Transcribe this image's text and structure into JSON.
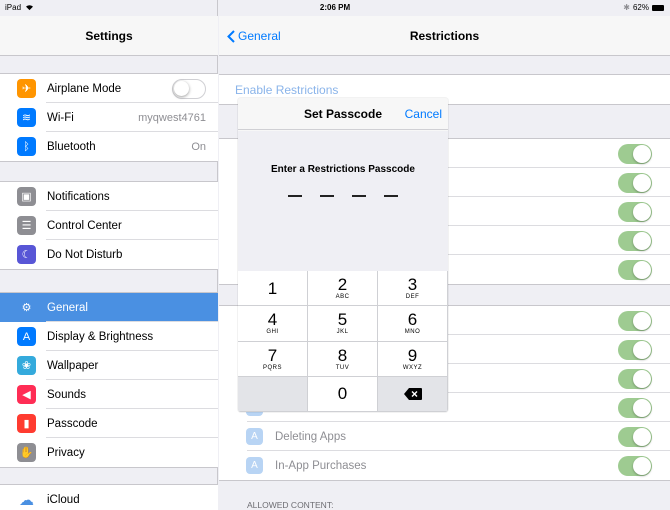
{
  "status": {
    "device": "iPad",
    "time": "2:06 PM",
    "battery": "62%"
  },
  "sidebar": {
    "title": "Settings",
    "groups": [
      [
        {
          "label": "Airplane Mode",
          "icon": "airplane-icon",
          "color": "#ff9500",
          "toggle": "off"
        },
        {
          "label": "Wi-Fi",
          "icon": "wifi-icon",
          "color": "#007aff",
          "value": "myqwest4761"
        },
        {
          "label": "Bluetooth",
          "icon": "bluetooth-icon",
          "color": "#007aff",
          "value": "On"
        }
      ],
      [
        {
          "label": "Notifications",
          "icon": "notifications-icon",
          "color": "#8e8e93"
        },
        {
          "label": "Control Center",
          "icon": "control-center-icon",
          "color": "#8e8e93"
        },
        {
          "label": "Do Not Disturb",
          "icon": "moon-icon",
          "color": "#5856d6"
        }
      ],
      [
        {
          "label": "General",
          "icon": "gear-icon",
          "color": "#8e8e93",
          "active": true
        },
        {
          "label": "Display & Brightness",
          "icon": "display-icon",
          "color": "#007aff"
        },
        {
          "label": "Wallpaper",
          "icon": "wallpaper-icon",
          "color": "#34aadc"
        },
        {
          "label": "Sounds",
          "icon": "speaker-icon",
          "color": "#ff2d55"
        },
        {
          "label": "Passcode",
          "icon": "lock-icon",
          "color": "#ff3b30"
        },
        {
          "label": "Privacy",
          "icon": "hand-icon",
          "color": "#8e8e93"
        }
      ],
      [
        {
          "label": "iCloud",
          "icon": "cloud-icon",
          "color": "#ffffff"
        }
      ]
    ]
  },
  "main": {
    "back_label": "General",
    "title": "Restrictions",
    "enable_label": "Enable Restrictions",
    "rows": [
      {
        "label": "Deleting Apps"
      },
      {
        "label": "In-App Purchases"
      }
    ],
    "section_label": "ALLOWED CONTENT:"
  },
  "modal": {
    "title": "Set Passcode",
    "cancel_label": "Cancel",
    "prompt": "Enter a Restrictions Passcode",
    "keys": [
      {
        "num": "1",
        "letters": ""
      },
      {
        "num": "2",
        "letters": "ABC"
      },
      {
        "num": "3",
        "letters": "DEF"
      },
      {
        "num": "4",
        "letters": "GHI"
      },
      {
        "num": "5",
        "letters": "JKL"
      },
      {
        "num": "6",
        "letters": "MNO"
      },
      {
        "num": "7",
        "letters": "PQRS"
      },
      {
        "num": "8",
        "letters": "TUV"
      },
      {
        "num": "9",
        "letters": "WXYZ"
      },
      {
        "num": "",
        "letters": ""
      },
      {
        "num": "0",
        "letters": ""
      },
      {
        "num": "",
        "letters": "",
        "icon": "backspace-icon"
      }
    ]
  }
}
